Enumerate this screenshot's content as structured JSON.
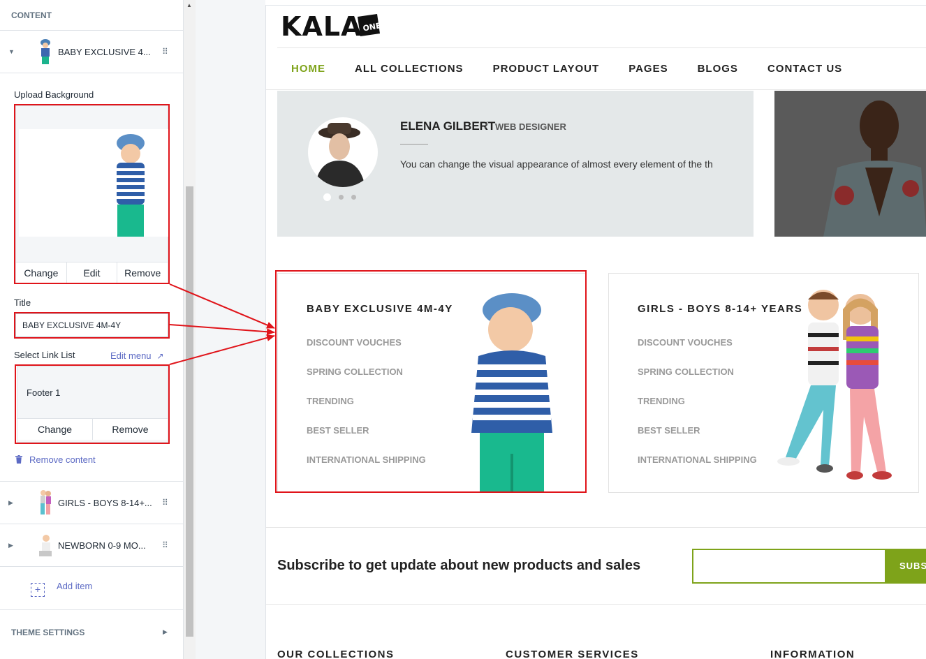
{
  "sidebar": {
    "header": "CONTENT",
    "active_block": {
      "label": "BABY EXCLUSIVE 4...",
      "caret": "▼",
      "drag": "⠿"
    },
    "upload": {
      "label": "Upload Background",
      "buttons": [
        "Change",
        "Edit",
        "Remove"
      ]
    },
    "title": {
      "label": "Title",
      "value": "BABY EXCLUSIVE 4M-4Y"
    },
    "link_list": {
      "label": "Select Link List",
      "edit_menu": "Edit menu",
      "value": "Footer 1",
      "buttons": [
        "Change",
        "Remove"
      ]
    },
    "remove_content": "Remove content",
    "blocks": [
      {
        "label": "GIRLS - BOYS 8-14+..."
      },
      {
        "label": "NEWBORN 0-9 MO..."
      }
    ],
    "add_item": "Add item",
    "theme_settings": "THEME SETTINGS"
  },
  "preview": {
    "logo": "KALA",
    "nav": [
      "HOME",
      "ALL COLLECTIONS",
      "PRODUCT LAYOUT",
      "PAGES",
      "BLOGS",
      "CONTACT US"
    ],
    "testimonial": {
      "name": "ELENA GILBERT",
      "role": "WEB DESIGNER",
      "quote": "You can change the visual appearance of almost every element of the th"
    },
    "cards": [
      {
        "title": "BABY EXCLUSIVE 4M-4Y",
        "links": [
          "DISCOUNT VOUCHES",
          "SPRING COLLECTION",
          "TRENDING",
          "BEST SELLER",
          "INTERNATIONAL SHIPPING"
        ]
      },
      {
        "title": "GIRLS - BOYS 8-14+ YEARS",
        "links": [
          "DISCOUNT VOUCHES",
          "SPRING COLLECTION",
          "TRENDING",
          "BEST SELLER",
          "INTERNATIONAL SHIPPING"
        ]
      }
    ],
    "subscribe": {
      "text": "Subscribe to get update about new products and sales",
      "button": "SUBS"
    },
    "footer_columns": [
      "OUR COLLECTIONS",
      "CUSTOMER SERVICES",
      "INFORMATION"
    ]
  },
  "colors": {
    "accent": "#7ea31a",
    "link": "#5c6ac4",
    "highlight": "#e0141a"
  }
}
